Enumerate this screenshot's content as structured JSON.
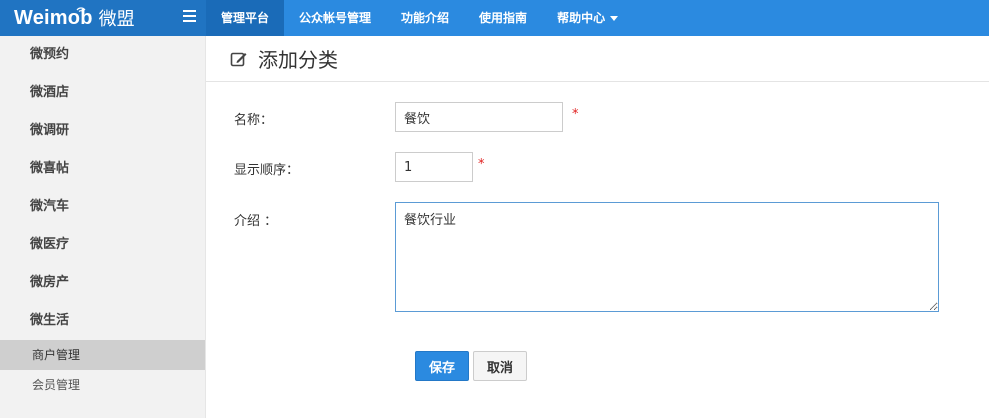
{
  "brand": {
    "name": "Weimob",
    "name_cn": "微盟"
  },
  "nav": {
    "items": [
      {
        "label": "管理平台",
        "active": true
      },
      {
        "label": "公众帐号管理",
        "active": false
      },
      {
        "label": "功能介绍",
        "active": false
      },
      {
        "label": "使用指南",
        "active": false
      },
      {
        "label": "帮助中心",
        "active": false,
        "dropdown": true
      }
    ]
  },
  "sidebar": {
    "groups": [
      "微预约",
      "微酒店",
      "微调研",
      "微喜帖",
      "微汽车",
      "微医疗",
      "微房产",
      "微生活"
    ],
    "subitems": [
      {
        "label": "商户管理",
        "active": true
      },
      {
        "label": "会员管理",
        "active": false
      }
    ]
  },
  "page": {
    "title": "添加分类"
  },
  "form": {
    "name_label": "名称：",
    "name_value": "餐饮",
    "order_label": "显示顺序：",
    "order_value": "1",
    "intro_label": "介绍 ：",
    "intro_value": "餐饮行业",
    "required_mark": "*",
    "save_label": "保存",
    "cancel_label": "取消"
  },
  "colors": {
    "topbar": "#2b8ae0",
    "primary_button": "#2b8ae0",
    "required": "#e02020"
  }
}
